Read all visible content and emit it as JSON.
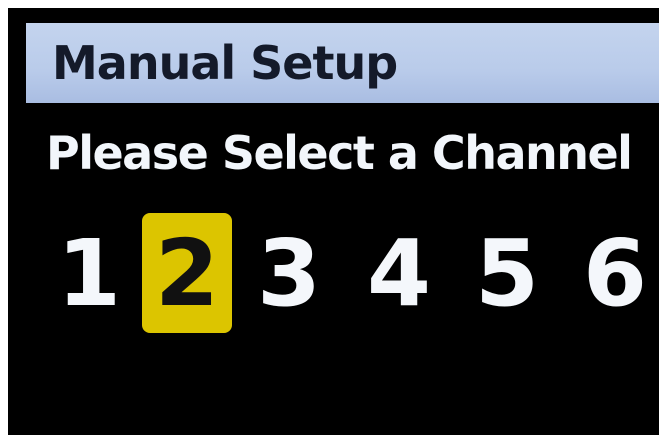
{
  "header": {
    "title": "Manual Setup"
  },
  "prompt": {
    "text": "Please Select a Channel"
  },
  "channels": {
    "selected": "2",
    "items": [
      {
        "label": "1"
      },
      {
        "label": "2"
      },
      {
        "label": "3"
      },
      {
        "label": "4"
      },
      {
        "label": "5"
      },
      {
        "label": "6"
      }
    ]
  },
  "colors": {
    "header_background": "#b9cbea",
    "selection_highlight": "#dcc500",
    "screen_background": "#000000",
    "text": "#f4f7fb"
  }
}
